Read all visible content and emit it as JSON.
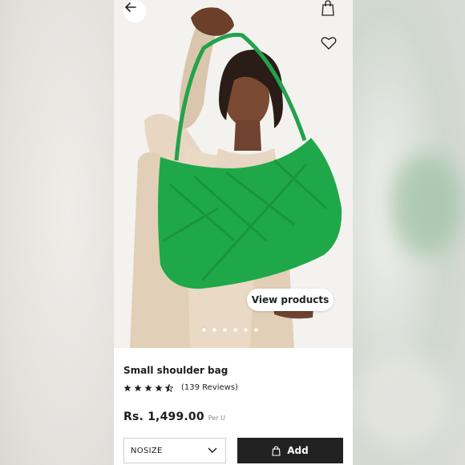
{
  "product": {
    "title": "Small shoulder bag",
    "reviews": "(139 Reviews)",
    "rating": 4.5,
    "price": "Rs. 1,499.00",
    "price_unit": "Per U"
  },
  "gallery": {
    "view_products_label": "View products",
    "image_count": 6,
    "active_index": 0
  },
  "size_select": {
    "selected": "NOSIZE"
  },
  "add_button": {
    "label": "Add"
  },
  "icons": {
    "back": "arrow-left-icon",
    "bag": "shopping-bag-icon",
    "favorite": "heart-icon",
    "dropdown": "chevron-down-icon",
    "cart": "bag-icon"
  },
  "colors": {
    "bag_green": "#1fa84a",
    "button_dark": "#222222",
    "background": "#ffffff"
  }
}
